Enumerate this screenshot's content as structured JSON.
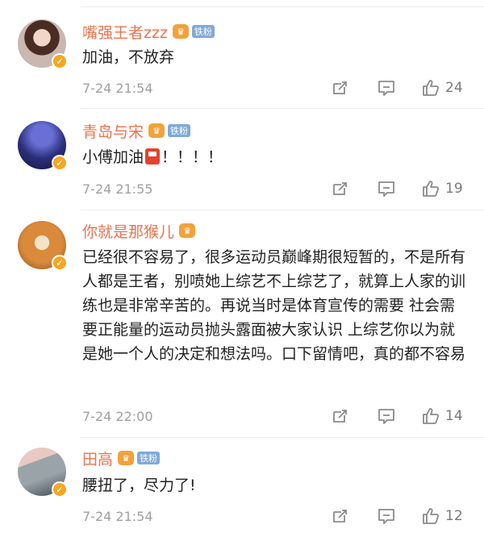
{
  "comments": [
    {
      "username": "嘴强王者zzz",
      "crown_glyph": "♛",
      "fan_badge": "铁粉",
      "verified_glyph": "✓",
      "text": "加油，不放弃",
      "time": "7-24 21:54",
      "likes": "24"
    },
    {
      "username": "青岛与宋",
      "crown_glyph": "♛",
      "fan_badge": "铁粉",
      "verified_glyph": "✓",
      "text_before": "小傅加油",
      "text_after": "！！！！",
      "emoji": "fuel-pump-emoji",
      "time": "7-24 21:55",
      "likes": "19"
    },
    {
      "username": "你就是那猴儿",
      "crown_glyph": "♛",
      "verified_glyph": "✓",
      "text": "已经很不容易了，很多运动员巅峰期很短暂的，不是所有人都是王者，别喷她上综艺不上综艺了，就算上人家的训练也是非常辛苦的。再说当时是体育宣传的需要 社会需要正能量的运动员抛头露面被大家认识 上综艺你以为就是她一个人的决定和想法吗。口下留情吧，真的都不容易",
      "time": "7-24 22:00",
      "likes": "14"
    },
    {
      "username": "田高",
      "crown_glyph": "♛",
      "fan_badge": "铁粉",
      "verified_glyph": "✓",
      "text": "腰扭了，尽力了!",
      "time": "7-24 21:54",
      "likes": "12"
    }
  ],
  "colors": {
    "username": "#eb7350",
    "crown": "#f2a23a",
    "fan_badge": "#7fa9d8",
    "meta": "#a0a0a0",
    "verified": "#f5a623"
  },
  "icons": [
    "repost-icon",
    "reply-icon",
    "like-icon",
    "verified-icon",
    "crown-icon"
  ]
}
